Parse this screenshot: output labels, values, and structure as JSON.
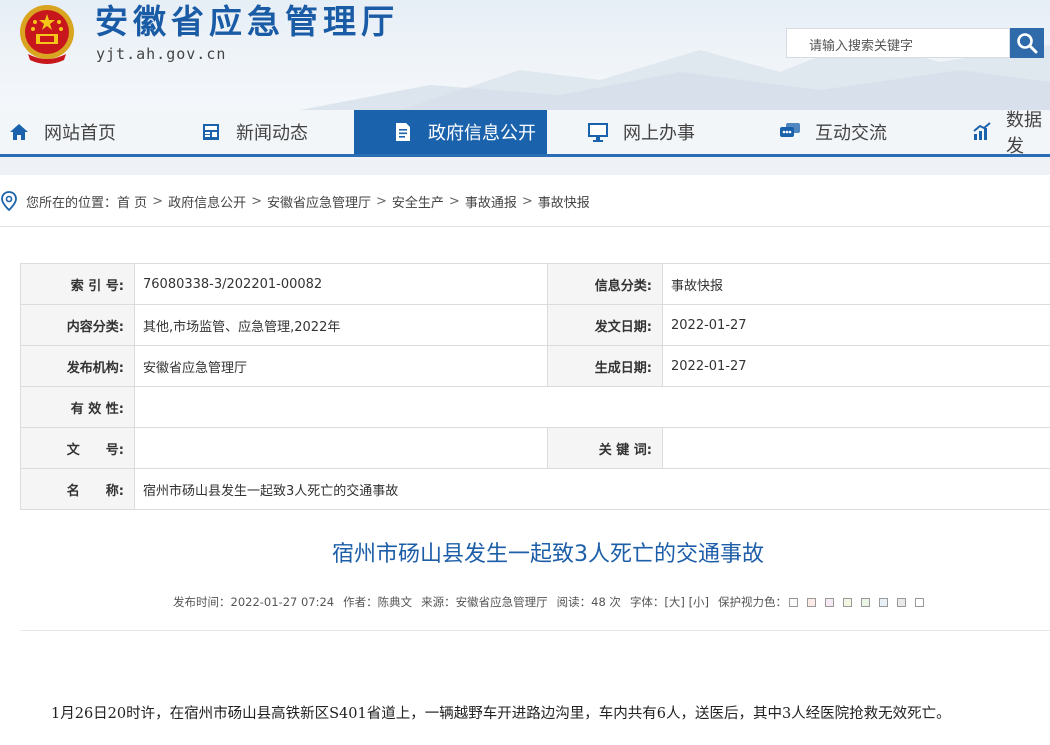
{
  "header": {
    "title": "安徽省应急管理厅",
    "domain": "yjt.ah.gov.cn",
    "search_placeholder": "请输入搜索关键字",
    "emblem": "national-emblem",
    "colors": {
      "brand": "#1a5ba6",
      "nav_active": "#1b62ad"
    }
  },
  "nav": {
    "items": [
      {
        "label": "网站首页",
        "icon": "home-icon"
      },
      {
        "label": "新闻动态",
        "icon": "news-icon"
      },
      {
        "label": "政府信息公开",
        "icon": "document-icon"
      },
      {
        "label": "网上办事",
        "icon": "monitor-icon"
      },
      {
        "label": "互动交流",
        "icon": "chat-icon"
      },
      {
        "label": "数据发",
        "icon": "chart-icon"
      }
    ],
    "active_index": 2
  },
  "breadcrumb": {
    "prefix": "您所在的位置：",
    "items": [
      "首 页",
      "政府信息公开",
      "安徽省应急管理厅",
      "安全生产",
      "事故通报",
      "事故快报"
    ]
  },
  "info": {
    "index_label": "索 引 号:",
    "index_value": "76080338-3/202201-00082",
    "category_label": "信息分类:",
    "category_value": "事故快报",
    "content_label": "内容分类:",
    "content_value": "其他,市场监管、应急管理,2022年",
    "issue_date_label": "发文日期:",
    "issue_date_value": "2022-01-27",
    "publisher_label": "发布机构:",
    "publisher_value": "安徽省应急管理厅",
    "created_date_label": "生成日期:",
    "created_date_value": "2022-01-27",
    "validity_label": "有 效 性:",
    "validity_value": "",
    "docno_label": "文　　号:",
    "docno_value": "",
    "keywords_label": "关 键 词:",
    "keywords_value": "",
    "name_label": "名　　称:",
    "name_value": "宿州市砀山县发生一起致3人死亡的交通事故"
  },
  "article": {
    "title": "宿州市砀山县发生一起致3人死亡的交通事故",
    "meta": {
      "publish_time": "发布时间：2022-01-27 07:24",
      "author": "作者：陈典文",
      "source": "来源：安徽省应急管理厅",
      "views": "阅读：48 次",
      "font_size": "字体：[大] [小]",
      "eye_color_label": "保护视力色："
    },
    "eye_colors": [
      "#fafafa",
      "#fcebe7",
      "#f5eaf5",
      "#f1f7e2",
      "#e9f6e6",
      "#e7f1f7",
      "#eaeaea",
      "#ffffff"
    ],
    "body": "1月26日20时许，在宿州市砀山县高铁新区S401省道上，一辆越野车开进路边沟里，车内共有6人，送医后，其中3人经医院抢救无效死亡。"
  }
}
